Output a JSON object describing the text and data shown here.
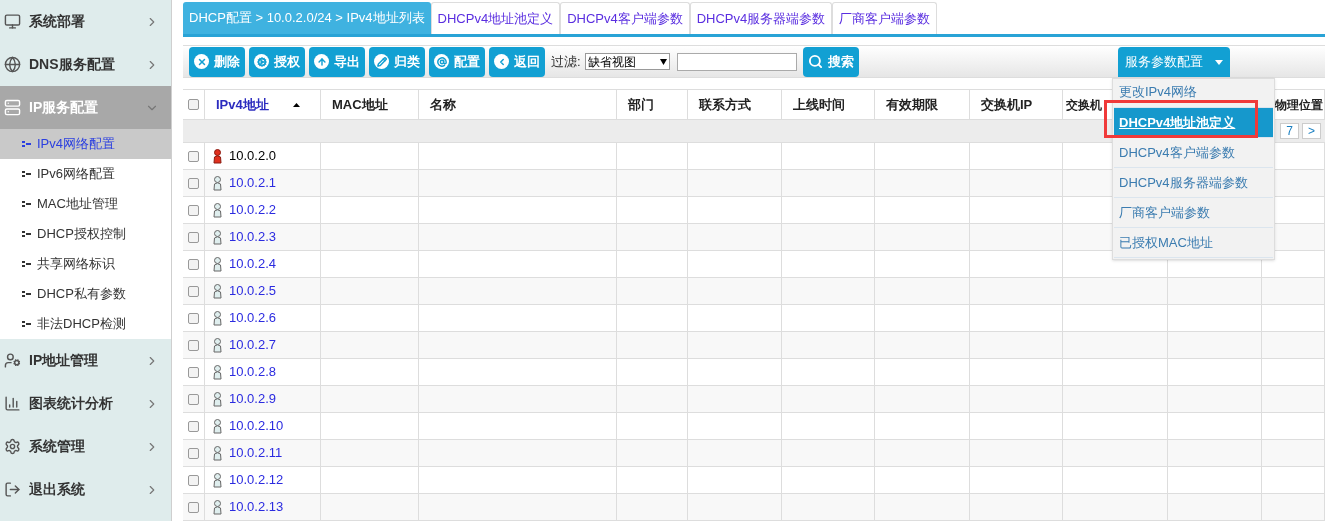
{
  "sidebar": {
    "sections": [
      {
        "label": "系统部署",
        "expanded": false,
        "selected": false
      },
      {
        "label": "DNS服务配置",
        "expanded": false,
        "selected": false
      },
      {
        "label": "IP服务配置",
        "expanded": true,
        "selected": true,
        "children": [
          {
            "label": "IPv4网络配置",
            "selected": true
          },
          {
            "label": "IPv6网络配置",
            "selected": false
          },
          {
            "label": "MAC地址管理",
            "selected": false
          },
          {
            "label": "DHCP授权控制",
            "selected": false
          },
          {
            "label": "共享网络标识",
            "selected": false
          },
          {
            "label": "DHCP私有参数",
            "selected": false
          },
          {
            "label": "非法DHCP检测",
            "selected": false
          }
        ]
      },
      {
        "label": "IP地址管理",
        "expanded": false,
        "selected": false
      },
      {
        "label": "图表统计分析",
        "expanded": false,
        "selected": false
      },
      {
        "label": "系统管理",
        "expanded": false,
        "selected": false
      },
      {
        "label": "退出系统",
        "expanded": false,
        "selected": false
      }
    ]
  },
  "tabs": [
    {
      "label": "DHCP配置 > 10.0.2.0/24 > IPv4地址列表",
      "selected": true
    },
    {
      "label": "DHCPv4地址池定义",
      "selected": false
    },
    {
      "label": "DHCPv4客户端参数",
      "selected": false
    },
    {
      "label": "DHCPv4服务器端参数",
      "selected": false
    },
    {
      "label": "厂商客户端参数",
      "selected": false
    }
  ],
  "toolbar": {
    "buttons": [
      {
        "label": "删除"
      },
      {
        "label": "授权"
      },
      {
        "label": "导出"
      },
      {
        "label": "归类"
      },
      {
        "label": "配置"
      },
      {
        "label": "返回"
      }
    ],
    "filter_label": "过滤:",
    "filter_value": "缺省视图",
    "search_button": "搜索",
    "menu_button": "服务参数配置",
    "menu": [
      {
        "label": "更改IPv4网络",
        "selected": false
      },
      {
        "label": "DHCPv4地址池定义",
        "selected": true
      },
      {
        "label": "DHCPv4客户端参数",
        "selected": false
      },
      {
        "label": "DHCPv4服务器端参数",
        "selected": false
      },
      {
        "label": "厂商客户端参数",
        "selected": false
      },
      {
        "label": "已授权MAC地址",
        "selected": false
      }
    ]
  },
  "table": {
    "select_all_checked": false,
    "columns": [
      "IPv4地址",
      "MAC地址",
      "名称",
      "部门",
      "联系方式",
      "上线时间",
      "有效期限",
      "交换机IP",
      "交换机",
      "物理位置"
    ],
    "pager": [
      "7",
      ">"
    ],
    "rows": [
      {
        "ip": "10.0.2.0",
        "kind": "network",
        "checked": false
      },
      {
        "ip": "10.0.2.1",
        "kind": "host",
        "checked": false
      },
      {
        "ip": "10.0.2.2",
        "kind": "host",
        "checked": false
      },
      {
        "ip": "10.0.2.3",
        "kind": "host",
        "checked": false
      },
      {
        "ip": "10.0.2.4",
        "kind": "host",
        "checked": false
      },
      {
        "ip": "10.0.2.5",
        "kind": "host",
        "checked": false
      },
      {
        "ip": "10.0.2.6",
        "kind": "host",
        "checked": false
      },
      {
        "ip": "10.0.2.7",
        "kind": "host",
        "checked": false
      },
      {
        "ip": "10.0.2.8",
        "kind": "host",
        "checked": false
      },
      {
        "ip": "10.0.2.9",
        "kind": "host",
        "checked": false
      },
      {
        "ip": "10.0.2.10",
        "kind": "host",
        "checked": false
      },
      {
        "ip": "10.0.2.11",
        "kind": "host",
        "checked": false
      },
      {
        "ip": "10.0.2.12",
        "kind": "host",
        "checked": false
      },
      {
        "ip": "10.0.2.13",
        "kind": "host",
        "checked": false
      }
    ]
  }
}
